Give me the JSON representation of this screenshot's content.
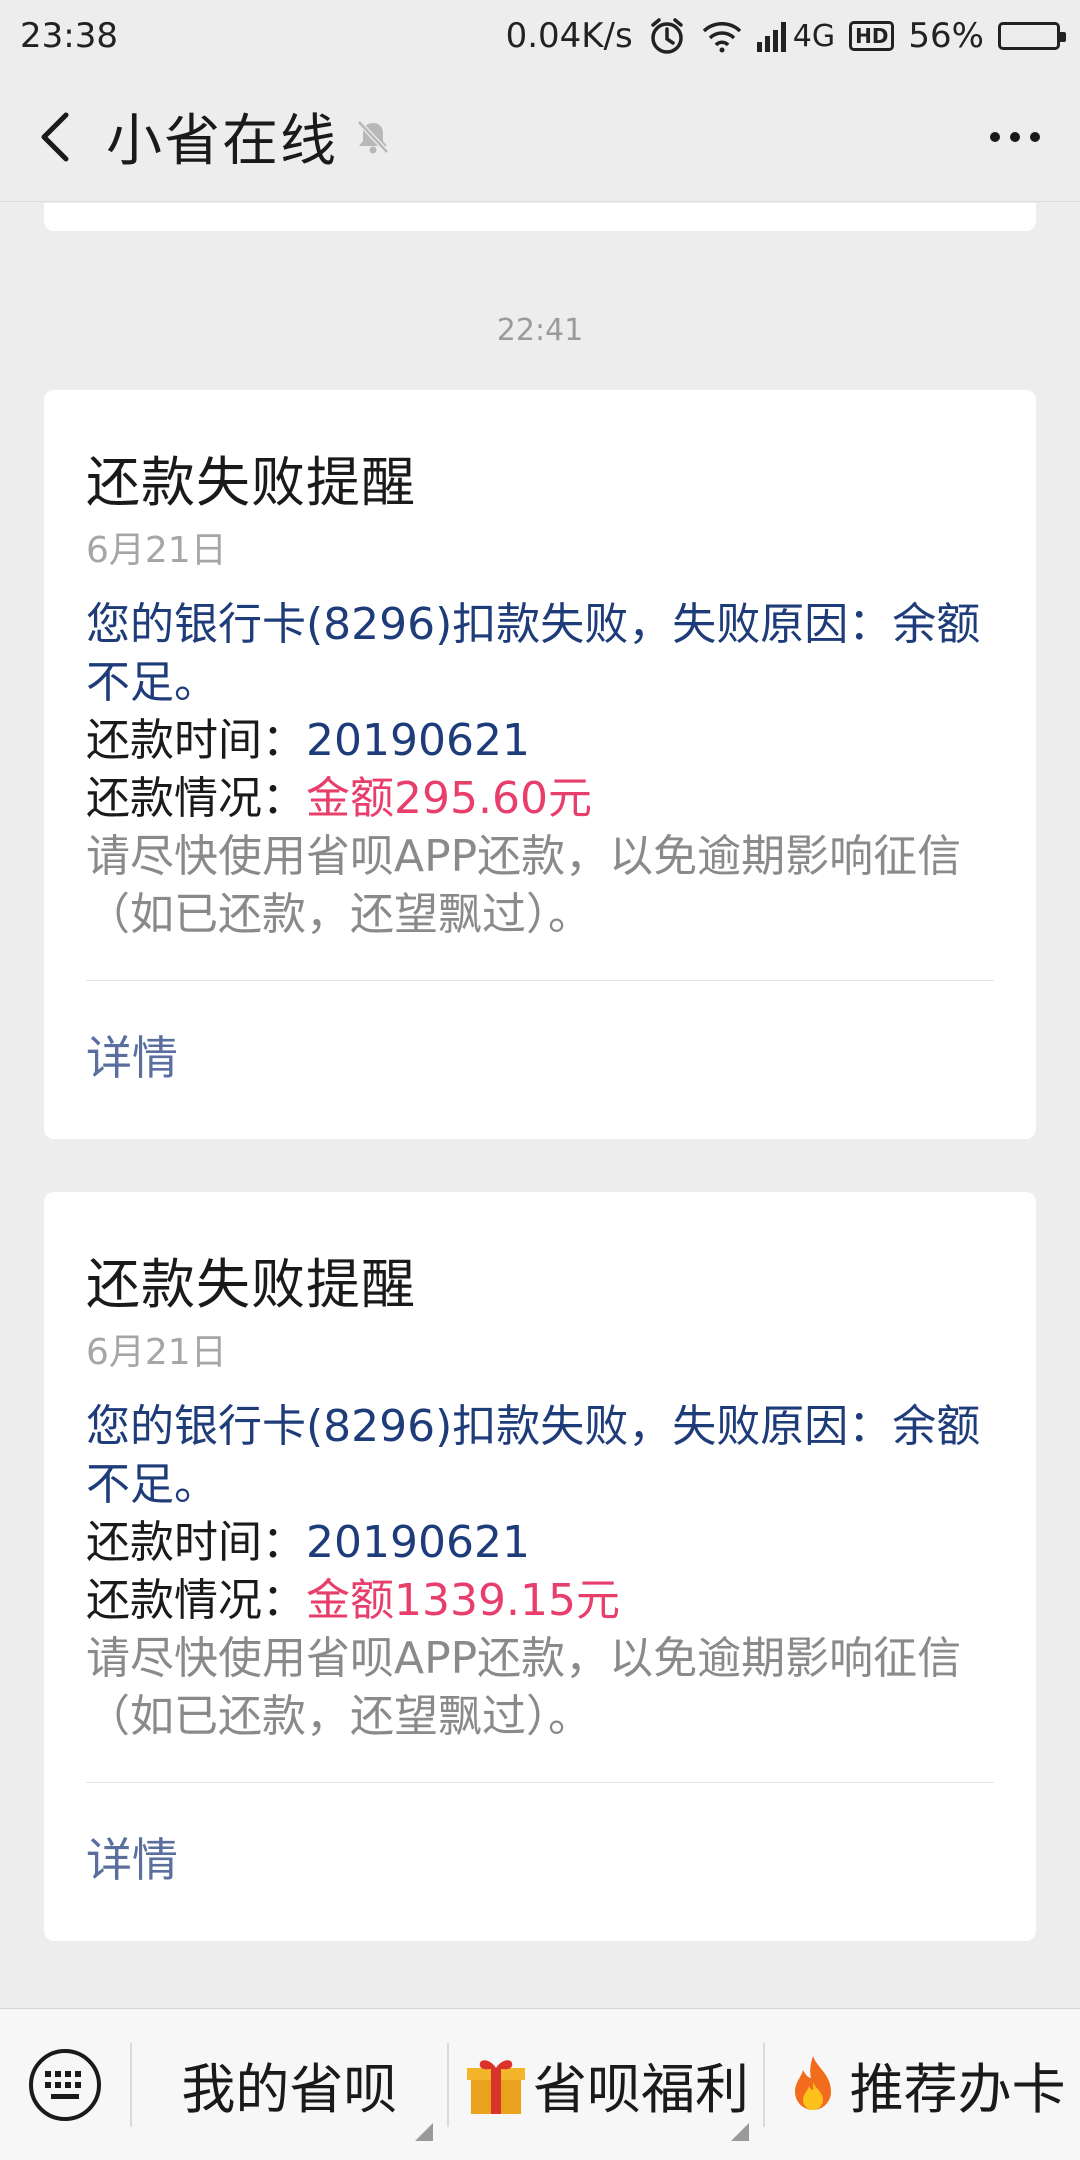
{
  "status_bar": {
    "time": "23:38",
    "net_speed": "0.04K/s",
    "network": "4G",
    "hd": "HD",
    "battery_pct": "56%",
    "battery_level": 0.56,
    "icons": [
      "alarm-icon",
      "wifi-icon",
      "signal-icon",
      "hd-icon",
      "battery-icon"
    ]
  },
  "header": {
    "title": "小省在线",
    "back_icon": "chevron-left-icon",
    "mute_icon": "muted-bell-icon",
    "more_icon": "more-dots-icon"
  },
  "chat": {
    "timestamp": "22:41",
    "cards": [
      {
        "title": "还款失败提醒",
        "date": "6月21日",
        "line1": "您的银行卡(8296)扣款失败，失败原因：余额不足。",
        "time_label": "还款时间：",
        "time_value": "20190621",
        "status_label": "还款情况：",
        "status_value": "金额295.60元",
        "note": "请尽快使用省呗APP还款，以免逾期影响征信（如已还款，还望飘过）。",
        "detail": "详情"
      },
      {
        "title": "还款失败提醒",
        "date": "6月21日",
        "line1": "您的银行卡(8296)扣款失败，失败原因：余额不足。",
        "time_label": "还款时间：",
        "time_value": "20190621",
        "status_label": "还款情况：",
        "status_value": "金额1339.15元",
        "note": "请尽快使用省呗APP还款，以免逾期影响征信（如已还款，还望飘过）。",
        "detail": "详情"
      }
    ]
  },
  "bottom_menu": {
    "keyboard_icon": "keyboard-icon",
    "items": [
      {
        "label": "我的省呗",
        "icon": ""
      },
      {
        "label": "省呗福利",
        "icon": "gift-icon"
      },
      {
        "label": "推荐办卡",
        "icon": "fire-icon"
      }
    ]
  },
  "colors": {
    "background": "#ededed",
    "card": "#ffffff",
    "blue_text": "#1f3c7a",
    "red_amount": "#e83e6c",
    "link": "#5a6f9e"
  }
}
